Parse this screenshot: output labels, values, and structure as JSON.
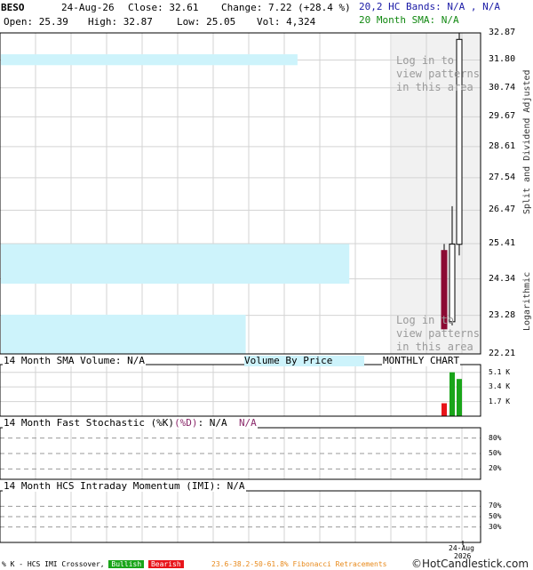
{
  "header": {
    "symbol": "BESO",
    "date": "24-Aug-26",
    "close": "Close: 32.61",
    "change": "Change: 7.22 (+28.4 %)",
    "open": "Open: 25.39",
    "high": "High: 32.87",
    "low": "Low: 25.05",
    "volume": "Vol: 4,324",
    "bands": "20,2 HC Bands: N/A , N/A",
    "sma": "20 Month SMA: N/A"
  },
  "main_panel": {
    "login_top": [
      "Log in to",
      "view patterns",
      "in this area"
    ],
    "login_bottom": [
      "Log in to",
      "view patterns",
      "in this area"
    ],
    "y_ticks": [
      "32.87",
      "31.80",
      "30.74",
      "29.67",
      "28.61",
      "27.54",
      "26.47",
      "25.41",
      "24.34",
      "23.28",
      "22.21"
    ],
    "side_right_top": "Split and Dividend Adjusted",
    "side_right_bottom": "Logarithmic",
    "volume_by_price_label": "Volume By Price",
    "chart_period": "MONTHLY CHART",
    "sma_volume_label": "14 Month SMA Volume: N/A"
  },
  "volume_panel": {
    "ticks": [
      "5.1 K",
      "3.4 K",
      "1.7 K"
    ]
  },
  "stoch_panel": {
    "label_main": "14 Month Fast Stochastic (%K)",
    "label_d": "(%D)",
    "label_val": ": N/A",
    "label_na": "N/A",
    "ticks": [
      "80%",
      "50%",
      "20%"
    ]
  },
  "imi_panel": {
    "label": "14 Month HCS Intraday Momentum (IMI): N/A",
    "ticks": [
      "70%",
      "50%",
      "30%"
    ]
  },
  "x_axis": {
    "date_label": "24-Aug",
    "year_label": "2026"
  },
  "footer": {
    "legend_text": "% K - HCS IMI Crossover,",
    "bullish": "Bullish",
    "bearish": "Bearish",
    "fib": "23.6-38.2-50-61.8% Fibonacci Retracements",
    "copyright": "©HotCandlestick.com"
  },
  "colors": {
    "up": "#ffffff",
    "down": "#8b0a33",
    "vol_up": "#1aa51a",
    "vol_down": "#e8141a",
    "vbp": "#cdf3fb",
    "login_bg": "#f1f1f1"
  },
  "chart_data": {
    "type": "candlestick",
    "scale": "logarithmic",
    "ylim": [
      22.21,
      32.87
    ],
    "candles": [
      {
        "open": 25.2,
        "high": 25.4,
        "low": 22.9,
        "close": 22.9,
        "volume": 1500
      },
      {
        "open": 23.1,
        "high": 26.6,
        "low": 23.0,
        "close": 25.4,
        "volume": 5100
      },
      {
        "open": 25.39,
        "high": 32.87,
        "low": 25.05,
        "close": 32.61,
        "volume": 4324
      }
    ],
    "volume_by_price": [
      {
        "low": 31.6,
        "high": 32.87,
        "relative": 0.63
      },
      {
        "low": 24.2,
        "high": 25.4,
        "relative": 0.74
      },
      {
        "low": 22.21,
        "high": 23.3,
        "relative": 0.52
      }
    ],
    "volume_ticks": [
      5100,
      3400,
      1700
    ],
    "stoch_ticks": [
      80,
      50,
      20
    ],
    "imi_ticks": [
      70,
      50,
      30
    ]
  }
}
